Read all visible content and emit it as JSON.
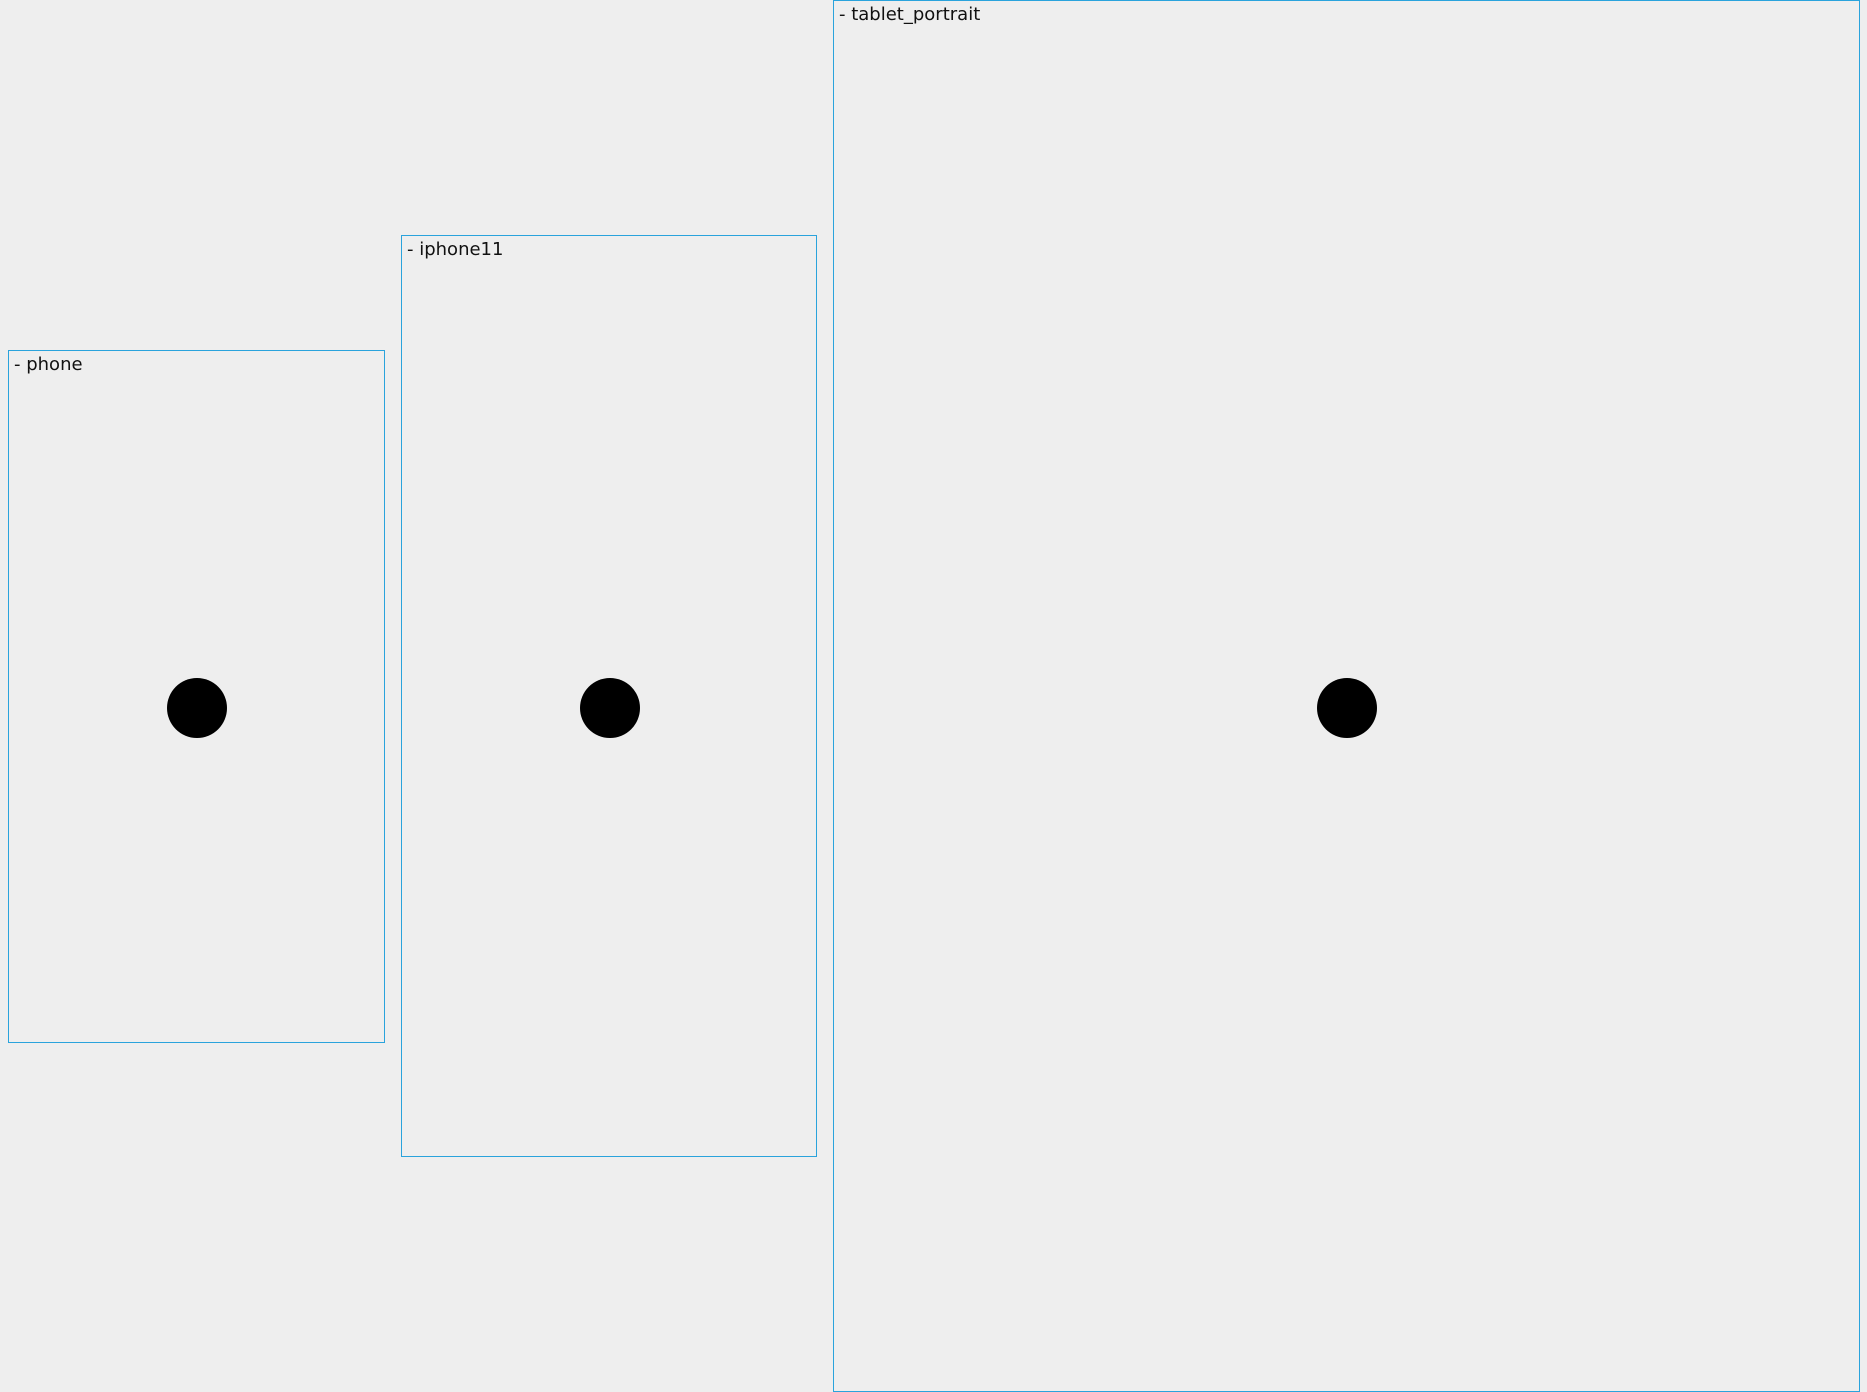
{
  "frames": [
    {
      "label": "- phone",
      "content": "circle"
    },
    {
      "label": "- iphone11",
      "content": "circle"
    },
    {
      "label": "- tablet_portrait",
      "content": "circle"
    }
  ],
  "colors": {
    "background": "#eeeeee",
    "frame_border": "#2aa3dc",
    "dot": "#000000",
    "label_text": "#111111"
  }
}
